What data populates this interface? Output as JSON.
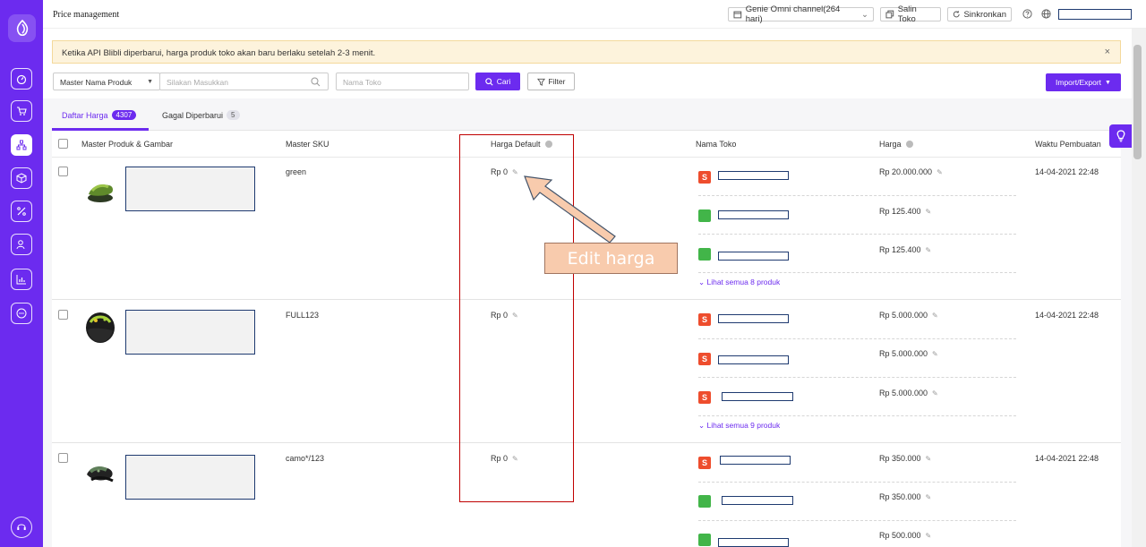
{
  "topbar": {
    "page_title": "Price management",
    "channel_select": "Genie Omni channel(264 hari)",
    "copy_store_button": "Salin Toko",
    "sync_button": "Sinkronkan"
  },
  "alert": {
    "message": "Ketika API Blibli diperbarui, harga produk toko akan baru berlaku setelah 2-3 menit.",
    "close": "×"
  },
  "filters": {
    "field_select": "Master Nama Produk",
    "search_placeholder": "Silakan Masukkan",
    "store_placeholder": "Nama Toko",
    "search_button": "Cari",
    "filter_button": "Filter",
    "import_export_button": "Import/Export"
  },
  "tabs": [
    {
      "label": "Daftar Harga",
      "count": "4307"
    },
    {
      "label": "Gagal Diperbarui",
      "count": "5"
    }
  ],
  "columns": {
    "product": "Master Produk & Gambar",
    "sku": "Master SKU",
    "default_price": "Harga Default",
    "store_name": "Nama Toko",
    "price": "Harga",
    "created": "Waktu Pembuatan"
  },
  "rows": [
    {
      "sku": "green",
      "default_price": "Rp 0",
      "created": "14-04-2021 22:48",
      "stores": [
        {
          "shop": "shopee",
          "price": "Rp 20.000.000"
        },
        {
          "shop": "tokopedia",
          "price": "Rp 125.400"
        },
        {
          "shop": "tokopedia",
          "price": "Rp 125.400"
        }
      ],
      "see_all": "Lihat semua 8 produk"
    },
    {
      "sku": "FULL123",
      "default_price": "Rp 0",
      "created": "14-04-2021 22:48",
      "stores": [
        {
          "shop": "shopee",
          "price": "Rp 5.000.000"
        },
        {
          "shop": "shopee",
          "price": "Rp 5.000.000"
        },
        {
          "shop": "shopee",
          "price": "Rp 5.000.000"
        }
      ],
      "see_all": "Lihat semua 9 produk"
    },
    {
      "sku": "camo*/123",
      "default_price": "Rp 0",
      "created": "14-04-2021 22:48",
      "stores": [
        {
          "shop": "shopee",
          "price": "Rp 350.000"
        },
        {
          "shop": "tokopedia",
          "price": "Rp 350.000"
        },
        {
          "shop": "tokopedia",
          "price": "Rp 500.000"
        }
      ]
    }
  ],
  "annotation": {
    "label": "Edit harga"
  },
  "colors": {
    "accent": "#6c2bef",
    "alert_bg": "#fdf3dc",
    "annotation_box": "#c00000",
    "callout_fill": "#f8cbad"
  }
}
